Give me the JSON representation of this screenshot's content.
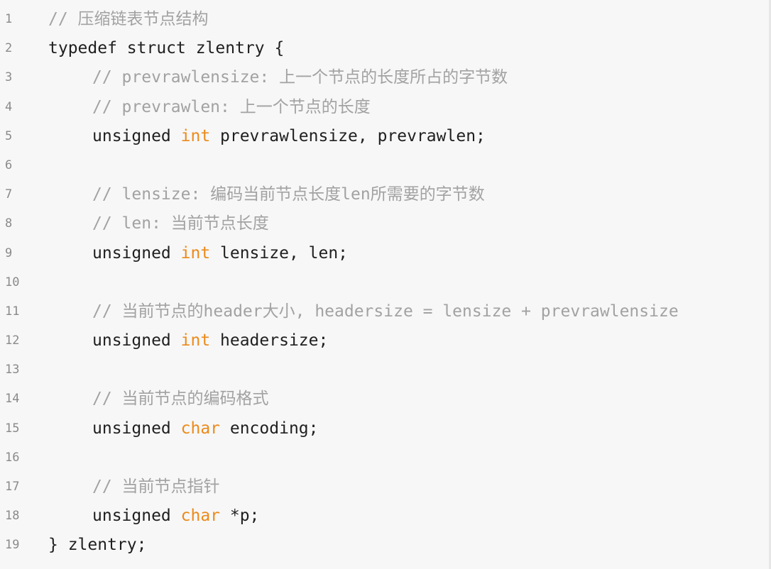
{
  "code": {
    "lines": [
      {
        "n": "1",
        "comment": "// 压缩链表节点结构"
      },
      {
        "n": "2",
        "text": "typedef struct zlentry {"
      },
      {
        "n": "3",
        "comment": "// prevrawlensize: 上一个节点的长度所占的字节数"
      },
      {
        "n": "4",
        "comment": "// prevrawlen: 上一个节点的长度"
      },
      {
        "n": "5",
        "pre": "unsigned ",
        "type": "int",
        "post": " prevrawlensize, prevrawlen;"
      },
      {
        "n": "6"
      },
      {
        "n": "7",
        "comment": "// lensize: 编码当前节点长度len所需要的字节数"
      },
      {
        "n": "8",
        "comment": "// len: 当前节点长度"
      },
      {
        "n": "9",
        "pre": "unsigned ",
        "type": "int",
        "post": " lensize, len;"
      },
      {
        "n": "10"
      },
      {
        "n": "11",
        "comment": "// 当前节点的header大小, headersize = lensize + prevrawlensize"
      },
      {
        "n": "12",
        "pre": "unsigned ",
        "type": "int",
        "post": " headersize;"
      },
      {
        "n": "13"
      },
      {
        "n": "14",
        "comment": "// 当前节点的编码格式"
      },
      {
        "n": "15",
        "pre": "unsigned ",
        "type": "char",
        "post": " encoding;"
      },
      {
        "n": "16"
      },
      {
        "n": "17",
        "comment": "// 当前节点指针"
      },
      {
        "n": "18",
        "pre": "unsigned ",
        "type": "char",
        "post": " *p;"
      },
      {
        "n": "19",
        "text": "} zlentry;"
      }
    ]
  }
}
